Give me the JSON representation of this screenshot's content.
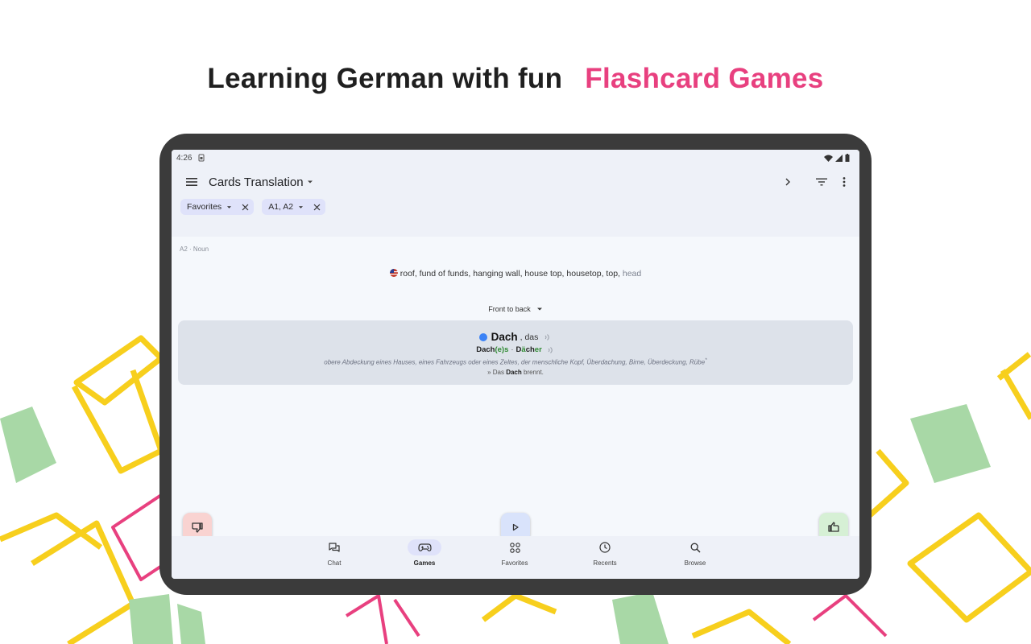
{
  "headline": {
    "part1": "Learning German with fun",
    "part2": "Flashcard Games",
    "accent_color": "#e8407f"
  },
  "status_bar": {
    "time": "4:26",
    "icons": [
      "sim-icon",
      "wifi-icon",
      "signal-icon",
      "battery-icon"
    ]
  },
  "toolbar": {
    "title": "Cards Translation",
    "icons": [
      "menu-icon",
      "chevron-down-icon",
      "chevron-right-icon",
      "filter-icon",
      "more-vert-icon"
    ]
  },
  "filters": [
    {
      "label": "Favorites"
    },
    {
      "label": "A1, A2"
    }
  ],
  "entry": {
    "meta": "A2 · Noun",
    "translation_main": "roof, fund of funds, hanging wall, house top, housetop, top,",
    "translation_dim": " head",
    "direction": "Front to back",
    "word": "Dach",
    "article": ", das",
    "genitive_stem": "Dach",
    "genitive_suffix": "(e)s",
    "separator": " · ",
    "plural_prefix": "D",
    "plural_umlaut": "ä",
    "plural_mid": "ch",
    "plural_suffix": "er",
    "definition": "obere Abdeckung eines Hauses, eines Fahrzeugs oder eines Zeltes, der menschliche Kopf, Überdachung, Birne, Überdeckung, Rübe",
    "definition_mark": "*",
    "example_prefix": "» Das ",
    "example_word": "Dach",
    "example_suffix": " brennt."
  },
  "fabs": [
    "thumb-down-icon",
    "play-icon",
    "thumb-up-icon"
  ],
  "bottom_nav": [
    {
      "label": "Chat",
      "icon": "chat-icon"
    },
    {
      "label": "Games",
      "icon": "gamepad-icon",
      "active": true
    },
    {
      "label": "Favorites",
      "icon": "grid-icon"
    },
    {
      "label": "Recents",
      "icon": "clock-icon"
    },
    {
      "label": "Browse",
      "icon": "search-icon"
    }
  ],
  "colors": {
    "book_yellow": "#f7cf1d",
    "book_pink": "#e8407f",
    "book_green": "#a8d8a6",
    "tablet_frame": "#3b3b3b",
    "screen_bg": "#f5f8fc",
    "bar_bg": "#eef1f8",
    "chip_bg": "#dfe2fa",
    "card_bg": "#dde2ea"
  }
}
